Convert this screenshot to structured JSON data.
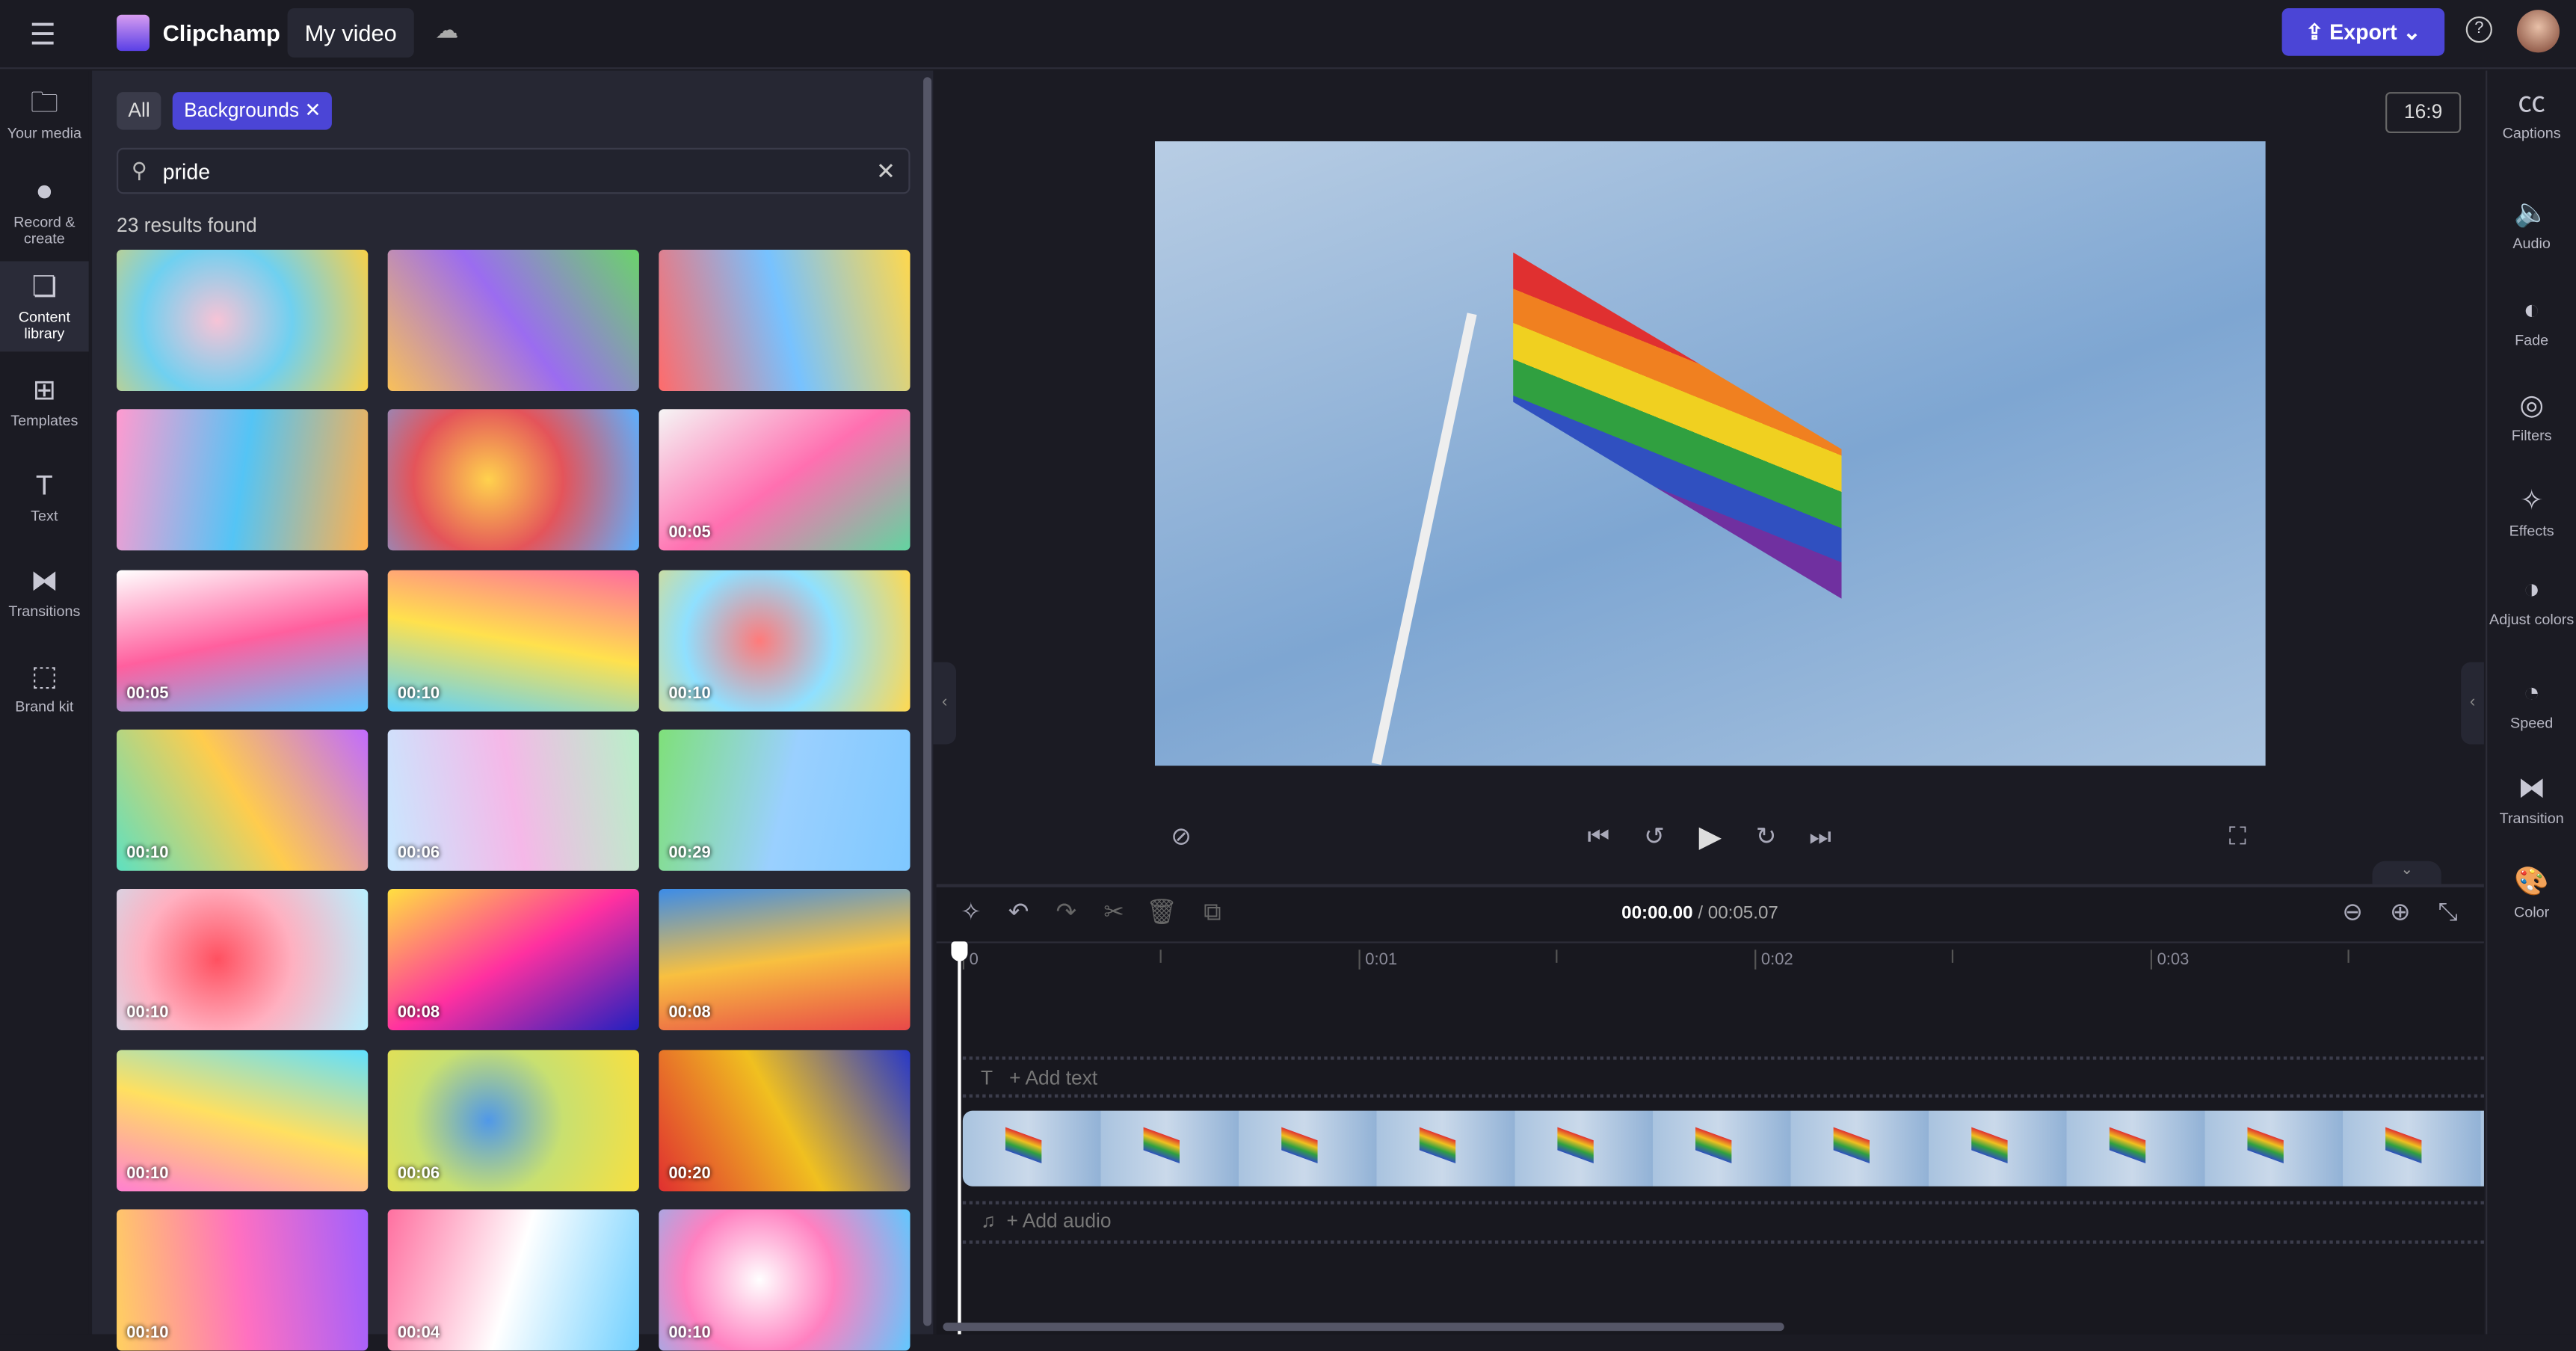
{
  "header": {
    "app_name": "Clipchamp",
    "project_title": "My video",
    "export_label": "Export",
    "menu_icon": "hamburger-icon",
    "cloud_icon": "cloud-off-icon",
    "help_icon": "help-icon",
    "accent": "#4b45d6"
  },
  "left_rail": [
    {
      "label": "Your media",
      "icon": "folder-icon",
      "glyph": "🗀"
    },
    {
      "label": "Record & create",
      "icon": "camera-icon",
      "glyph": "⏺"
    },
    {
      "label": "Content library",
      "icon": "library-icon",
      "glyph": "❏"
    },
    {
      "label": "Templates",
      "icon": "templates-icon",
      "glyph": "⊞"
    },
    {
      "label": "Text",
      "icon": "text-icon",
      "glyph": "T"
    },
    {
      "label": "Transitions",
      "icon": "transitions-icon",
      "glyph": "⧓"
    },
    {
      "label": "Brand kit",
      "icon": "brand-kit-icon",
      "glyph": "⬚"
    }
  ],
  "library": {
    "filter_all": "All",
    "filter_active": "Backgrounds",
    "search_value": "pride",
    "results": "23 results found",
    "items": [
      {
        "d": "",
        "c": [
          "#f7c3d6",
          "#6fd0f0",
          "#f9d048"
        ]
      },
      {
        "d": "",
        "c": [
          "#f8c05a",
          "#9b6cf0",
          "#6bd36b"
        ]
      },
      {
        "d": "",
        "c": [
          "#ff6b6b",
          "#77c2ff",
          "#ffd84d"
        ]
      },
      {
        "d": "",
        "c": [
          "#ff9bd0",
          "#54c4f5",
          "#ffb04d"
        ]
      },
      {
        "d": "",
        "c": [
          "#ffd24d",
          "#e4545a",
          "#5cb0ff"
        ]
      },
      {
        "d": "00:05",
        "c": [
          "#f5f5f5",
          "#ff6fb0",
          "#62d4a0"
        ]
      },
      {
        "d": "00:05",
        "c": [
          "#ffffff",
          "#ff5f9e",
          "#5ec5ff"
        ]
      },
      {
        "d": "00:10",
        "c": [
          "#ff6b9e",
          "#ffe14d",
          "#5bd1ff"
        ]
      },
      {
        "d": "00:10",
        "c": [
          "#ff7a7a",
          "#8fe0ff",
          "#ffd950"
        ]
      },
      {
        "d": "00:10",
        "c": [
          "#c06bff",
          "#ffcc4d",
          "#5ee0c0"
        ]
      },
      {
        "d": "00:06",
        "c": [
          "#b8f0c8",
          "#f5b8e8",
          "#c8e8ff"
        ]
      },
      {
        "d": "00:29",
        "c": [
          "#7fc8ff",
          "#9ad0ff",
          "#7fe07a"
        ]
      },
      {
        "d": "00:10",
        "c": [
          "#ff5060",
          "#ffb0c0",
          "#b8f0ff"
        ]
      },
      {
        "d": "00:08",
        "c": [
          "#2020c0",
          "#ff30a0",
          "#ffe040"
        ]
      },
      {
        "d": "00:08",
        "c": [
          "#e84848",
          "#f8c040",
          "#3c8ce8"
        ]
      },
      {
        "d": "00:10",
        "c": [
          "#ff80d0",
          "#ffe060",
          "#60e0ff"
        ]
      },
      {
        "d": "00:06",
        "c": [
          "#5098e8",
          "#c8e070",
          "#f8e040"
        ]
      },
      {
        "d": "00:20",
        "c": [
          "#e03030",
          "#f0c020",
          "#2838c8"
        ]
      },
      {
        "d": "00:10",
        "c": [
          "#ffd060",
          "#ff70c0",
          "#a060ff"
        ]
      },
      {
        "d": "00:04",
        "c": [
          "#ff70a0",
          "#ffffff",
          "#70d0ff"
        ]
      },
      {
        "d": "00:10",
        "c": [
          "#ffffff",
          "#ff80c0",
          "#60c8ff"
        ]
      }
    ]
  },
  "preview": {
    "aspect": "16:9"
  },
  "timeline": {
    "current": "00:00.00",
    "total": "/ 00:05.07",
    "ruler": [
      "0",
      "0:01",
      "0:02",
      "0:03"
    ],
    "add_text": "+ Add text",
    "add_audio": "+ Add audio"
  },
  "right_rail": [
    {
      "label": "Captions",
      "icon": "captions-icon",
      "glyph": "㏄"
    },
    {
      "label": "Audio",
      "icon": "speaker-icon",
      "glyph": "🔈"
    },
    {
      "label": "Fade",
      "icon": "fade-icon",
      "glyph": "◐"
    },
    {
      "label": "Filters",
      "icon": "filters-icon",
      "glyph": "◎"
    },
    {
      "label": "Effects",
      "icon": "effects-icon",
      "glyph": "✧"
    },
    {
      "label": "Adjust colors",
      "icon": "adjust-colors-icon",
      "glyph": "◑"
    },
    {
      "label": "Speed",
      "icon": "speed-icon",
      "glyph": "◔"
    },
    {
      "label": "Transition",
      "icon": "transition-icon",
      "glyph": "⧓"
    },
    {
      "label": "Color",
      "icon": "palette-icon",
      "glyph": "🎨"
    }
  ]
}
